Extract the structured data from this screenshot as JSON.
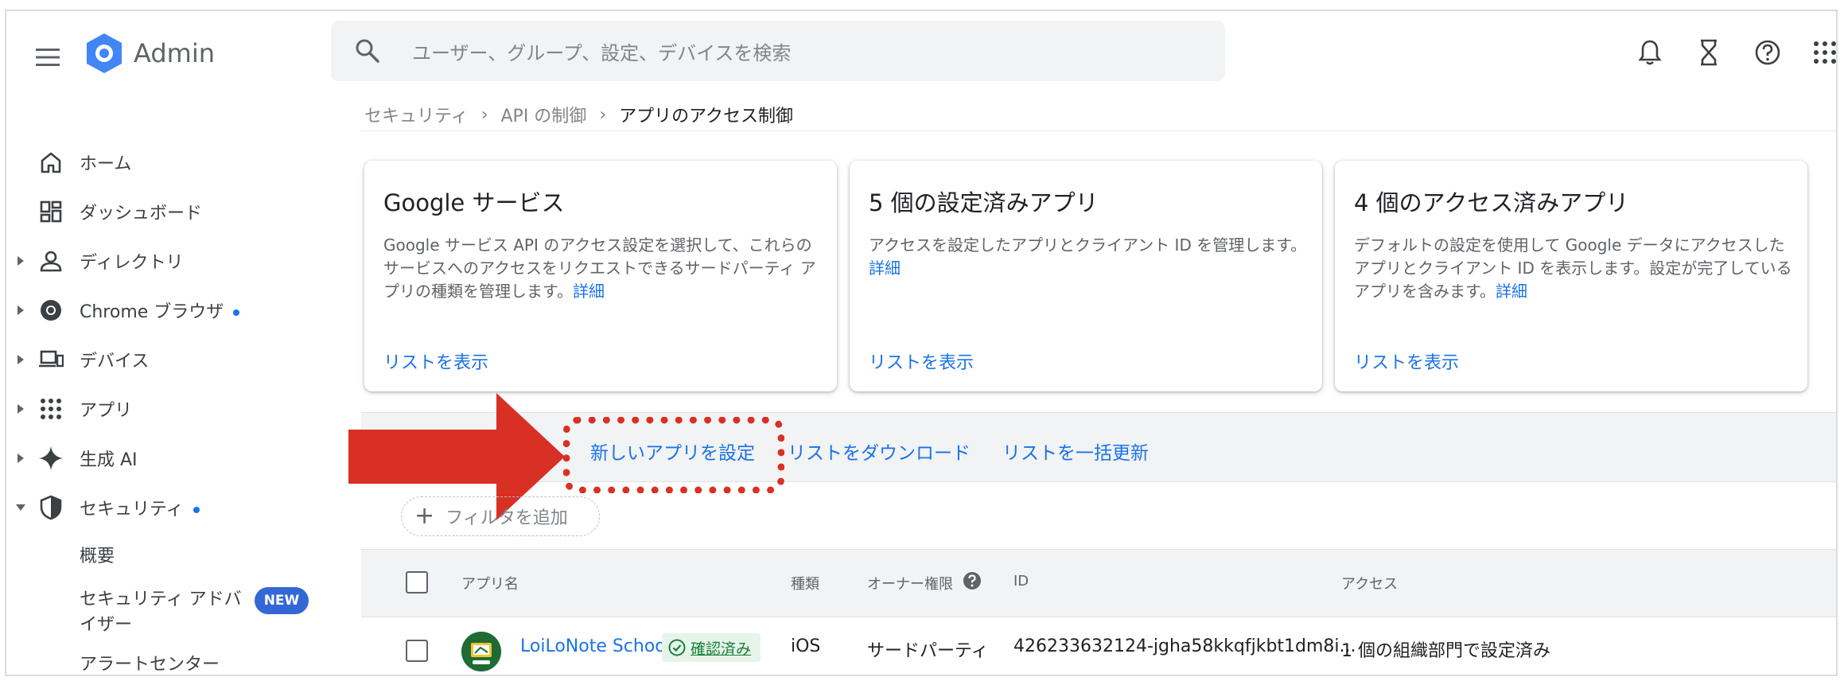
{
  "header": {
    "brand": "Admin",
    "search_placeholder": "ユーザー、グループ、設定、デバイスを検索",
    "icons": [
      "menu-icon",
      "bell-icon",
      "hourglass-icon",
      "help-icon",
      "apps-grid-icon"
    ]
  },
  "breadcrumb": {
    "items": [
      "セキュリティ",
      "API の制御",
      "アプリのアクセス制御"
    ]
  },
  "sidebar": {
    "items": [
      {
        "label": "ホーム",
        "icon": "home-icon"
      },
      {
        "label": "ダッシュボード",
        "icon": "dashboard-icon"
      },
      {
        "label": "ディレクトリ",
        "icon": "person-icon"
      },
      {
        "label": "Chrome ブラウザ",
        "icon": "chrome-icon"
      },
      {
        "label": "デバイス",
        "icon": "devices-icon"
      },
      {
        "label": "アプリ",
        "icon": "apps-icon"
      },
      {
        "label": "生成 AI",
        "icon": "sparkle-icon"
      },
      {
        "label": "セキュリティ",
        "icon": "shield-icon"
      }
    ],
    "sub_items": [
      "概要",
      "セキュリティ アドバイザー",
      "アラートセンター"
    ],
    "new_badge": "NEW"
  },
  "cards": [
    {
      "title": "Google サービス",
      "desc": "Google サービス API のアクセス設定を選択して、これらのサービスへのアクセスをリクエストできるサードパーティ アプリの種類を管理します。",
      "detail": "詳細",
      "link": "リストを表示"
    },
    {
      "title": "5 個の設定済みアプリ",
      "desc": "アクセスを設定したアプリとクライアント ID を管理します。",
      "detail": "詳細",
      "link": "リストを表示"
    },
    {
      "title": "4 個のアクセス済みアプリ",
      "desc": "デフォルトの設定を使用して Google データにアクセスしたアプリとクライアント ID を表示します。設定が完了しているアプリを含みます。",
      "detail": "詳細",
      "link": "リストを表示"
    }
  ],
  "toolbar": {
    "configure_new_app": "新しいアプリを設定",
    "download_list": "リストをダウンロード",
    "bulk_update": "リストを一括更新"
  },
  "filter": {
    "label": "フィルタを追加"
  },
  "table": {
    "columns": [
      "アプリ名",
      "種類",
      "オーナー権限",
      "ID",
      "アクセス"
    ],
    "rows": [
      {
        "app_name": "LoiLoNote School",
        "verified": "確認済み",
        "type": "iOS",
        "owner": "サードパーティ",
        "id": "426233632124-jgha58kkqfjkbt1dm8i...",
        "access": "1 個の組織部門で設定済み"
      }
    ]
  },
  "colors": {
    "accent": "#1a73e8",
    "highlight_red": "#d93025",
    "verified_green": "#188038",
    "toolbar_bg": "#f1f3f4"
  }
}
